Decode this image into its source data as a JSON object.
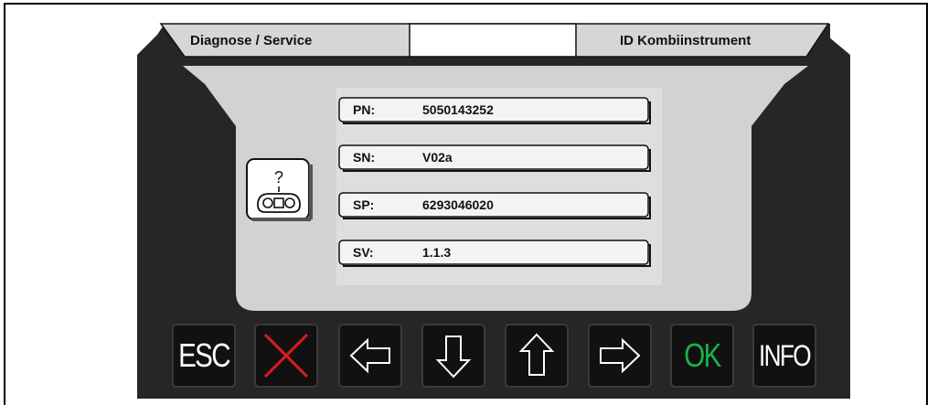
{
  "header": {
    "left_title": "Diagnose / Service",
    "center_title": "",
    "right_title": "ID Kombiinstrument"
  },
  "screen": {
    "icon": "controller-help-icon",
    "icon_text": "?",
    "fields": [
      {
        "label": "PN:",
        "value": "5050143252"
      },
      {
        "label": "SN:",
        "value": "V02a"
      },
      {
        "label": "SP:",
        "value": "6293046020"
      },
      {
        "label": "SV:",
        "value": "1.1.3"
      }
    ]
  },
  "buttons": [
    {
      "name": "esc",
      "label": "ESC",
      "icon": "esc-text",
      "color": "#ffffff"
    },
    {
      "name": "cancel",
      "label": "",
      "icon": "red-x-icon",
      "color": "#e01a1a"
    },
    {
      "name": "left",
      "label": "",
      "icon": "arrow-left-icon",
      "color": "#ffffff"
    },
    {
      "name": "down",
      "label": "",
      "icon": "arrow-down-icon",
      "color": "#ffffff"
    },
    {
      "name": "up",
      "label": "",
      "icon": "arrow-up-icon",
      "color": "#ffffff"
    },
    {
      "name": "right",
      "label": "",
      "icon": "arrow-right-icon",
      "color": "#ffffff"
    },
    {
      "name": "ok",
      "label": "OK",
      "icon": "ok-text",
      "color": "#19b34a"
    },
    {
      "name": "info",
      "label": "INFO",
      "icon": "info-text",
      "color": "#ffffff"
    }
  ],
  "colors": {
    "bezel": "#222222",
    "screen_bg": "#d4d4d4",
    "panel_bg": "#dcdcdc",
    "field_bg": "#f4f4f4",
    "button_bg": "#111111",
    "button_border": "#3a3a3a"
  }
}
